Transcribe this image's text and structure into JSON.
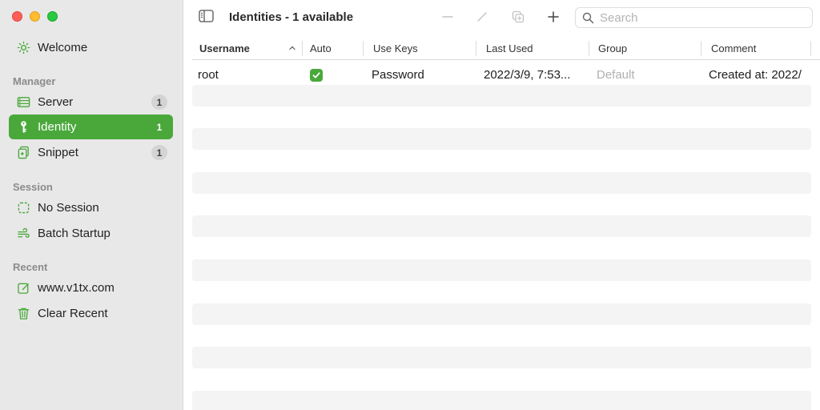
{
  "window": {
    "traffic_lights": {
      "close": "#fe5f57",
      "minimize": "#febc2e",
      "zoom": "#28c840"
    }
  },
  "sidebar": {
    "welcome": "Welcome",
    "sections": {
      "manager": "Manager",
      "session": "Session",
      "recent": "Recent"
    },
    "manager_items": [
      {
        "label": "Server",
        "count": "1",
        "icon": "server-icon"
      },
      {
        "label": "Identity",
        "count": "1",
        "icon": "key-icon",
        "active": true
      },
      {
        "label": "Snippet",
        "count": "1",
        "icon": "snippet-icon"
      }
    ],
    "session_items": [
      {
        "label": "No Session",
        "icon": "dashed-square-icon"
      },
      {
        "label": "Batch Startup",
        "icon": "wind-icon"
      }
    ],
    "recent_items": [
      {
        "label": "www.v1tx.com",
        "icon": "edit-square-icon"
      },
      {
        "label": "Clear Recent",
        "icon": "trash-icon"
      }
    ],
    "accent_color": "#4aa83b"
  },
  "toolbar": {
    "title": "Identities - 1 available",
    "search_placeholder": "Search"
  },
  "table": {
    "columns": [
      "Username",
      "Auto",
      "Use Keys",
      "Last Used",
      "Group",
      "Comment"
    ],
    "sort_column": "Username",
    "rows": [
      {
        "username": "root",
        "auto": true,
        "use_keys": "Password",
        "last_used": "2022/3/9, 7:53...",
        "group": "Default",
        "comment": "Created at: 2022/"
      }
    ]
  }
}
